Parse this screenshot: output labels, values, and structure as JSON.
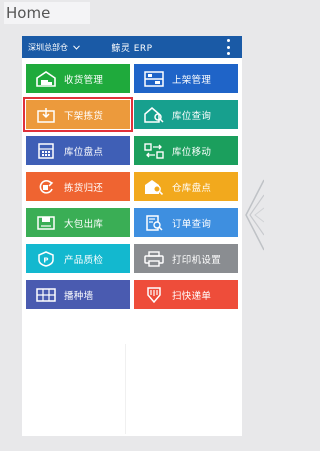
{
  "home": {
    "label": "Home"
  },
  "app": {
    "warehouse": "深圳总部仓",
    "title": "鲸灵 ERP"
  },
  "tiles": [
    {
      "label": "收货管理",
      "icon": "truck-warehouse-icon",
      "color": "#1faa3c"
    },
    {
      "label": "上架管理",
      "icon": "shelf-icon",
      "color": "#1f64c8"
    },
    {
      "label": "下架拣货",
      "icon": "box-down-icon",
      "color": "#ec9a3c",
      "selected": true
    },
    {
      "label": "库位查询",
      "icon": "location-search-icon",
      "color": "#17a08e"
    },
    {
      "label": "库位盘点",
      "icon": "calculator-icon",
      "color": "#3f5fb6"
    },
    {
      "label": "库位移动",
      "icon": "move-grid-icon",
      "color": "#1b9f5d"
    },
    {
      "label": "拣货归还",
      "icon": "return-icon",
      "color": "#ef6431"
    },
    {
      "label": "仓库盘点",
      "icon": "warehouse-search-icon",
      "color": "#f2a91d"
    },
    {
      "label": "大包出库",
      "icon": "package-out-icon",
      "color": "#3aae55"
    },
    {
      "label": "订单查询",
      "icon": "order-search-icon",
      "color": "#3e8fe0"
    },
    {
      "label": "产品质检",
      "icon": "quality-shield-icon",
      "color": "#13b8cf"
    },
    {
      "label": "打印机设置",
      "icon": "printer-icon",
      "color": "#8a8d91"
    },
    {
      "label": "播种墙",
      "icon": "seed-wall-icon",
      "color": "#4a5bb0"
    },
    {
      "label": "扫快递单",
      "icon": "scan-express-icon",
      "color": "#ee4d3a"
    }
  ]
}
